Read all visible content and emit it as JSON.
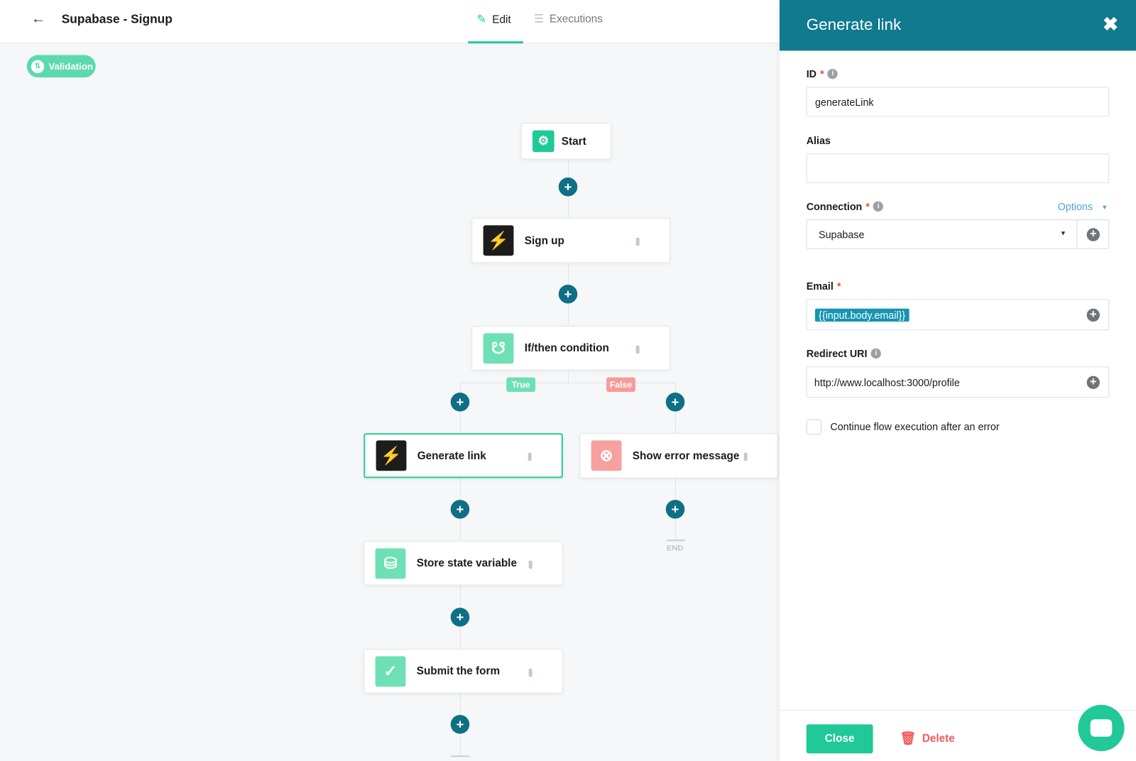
{
  "header": {
    "title": "Supabase - Signup",
    "tabs": [
      {
        "label": "Edit",
        "active": true
      },
      {
        "label": "Executions",
        "active": false
      }
    ]
  },
  "canvas": {
    "validation_label": "Validation",
    "nodes": {
      "start": "Start",
      "signup": "Sign up",
      "condition": "If/then condition",
      "generate": "Generate link",
      "error": "Show error message",
      "store": "Store state variable",
      "submit": "Submit the form"
    },
    "branches": {
      "true": "True",
      "false": "False"
    },
    "end_label": "END"
  },
  "panel": {
    "title": "Generate link",
    "id_label": "ID",
    "id_value": "generateLink",
    "alias_label": "Alias",
    "alias_value": "",
    "connection_label": "Connection",
    "options_label": "Options",
    "connection_value": "Supabase",
    "email_label": "Email",
    "email_value": "{{input.body.email}}",
    "redirect_label": "Redirect URI",
    "redirect_value": "http://www.localhost:3000/profile",
    "continue_label": "Continue flow execution after an error",
    "continue_checked": false,
    "close_label": "Close",
    "delete_label": "Delete"
  },
  "colors": {
    "accent": "#20c997",
    "teal": "#107a8f",
    "danger": "#f25c5c"
  }
}
